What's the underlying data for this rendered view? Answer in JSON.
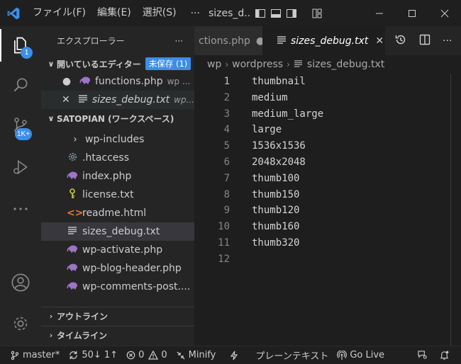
{
  "menu": {
    "file": "ファイル(F)",
    "edit": "編集(E)",
    "selection": "選択(S)",
    "more": "···"
  },
  "window": {
    "title": "sizes_d..."
  },
  "activity": {
    "explorer_badge": "1",
    "scm_badge": "1K+"
  },
  "sidebar": {
    "title": "エクスプローラー",
    "more": "···",
    "open_editors": {
      "label": "開いているエディター",
      "badge": "未保存 (1)",
      "items": [
        {
          "mark": "●",
          "name": "functions.php",
          "path": "wp ..."
        },
        {
          "mark": "✕",
          "name": "sizes_debug.txt",
          "path": "wp..."
        }
      ]
    },
    "workspace": {
      "label": "SATOPIAN (ワークスペース)",
      "items": [
        {
          "icon": "chevron",
          "name": "wp-includes"
        },
        {
          "icon": "gear",
          "name": ".htaccess"
        },
        {
          "icon": "php",
          "name": "index.php"
        },
        {
          "icon": "key",
          "name": "license.txt"
        },
        {
          "icon": "html",
          "name": "readme.html"
        },
        {
          "icon": "txt",
          "name": "sizes_debug.txt"
        },
        {
          "icon": "php",
          "name": "wp-activate.php"
        },
        {
          "icon": "php",
          "name": "wp-blog-header.php"
        },
        {
          "icon": "php",
          "name": "wp-comments-post...."
        }
      ]
    },
    "outline": "アウトライン",
    "timeline": "タイムライン"
  },
  "tabs": [
    {
      "name": "ctions.php",
      "dirty": "●"
    },
    {
      "name": "sizes_debug.txt",
      "close": "✕"
    }
  ],
  "breadcrumb": {
    "part1": "wp",
    "part2": "wordpress",
    "part3": "sizes_debug.txt"
  },
  "editor": {
    "lines": [
      "1",
      "2",
      "3",
      "4",
      "5",
      "6",
      "7",
      "8",
      "9",
      "10",
      "11",
      "12"
    ],
    "code": [
      "thumbnail",
      "medium",
      "medium_large",
      "large",
      "1536x1536",
      "2048x2048",
      "thumb100",
      "thumb150",
      "thumb120",
      "thumb160",
      "thumb320",
      ""
    ]
  },
  "status": {
    "branch": "master*",
    "sync": "50↓ 1↑",
    "errors": "0",
    "warnings": "0",
    "minify": "Minify",
    "plaintext": "プレーンテキスト",
    "golive": "Go Live"
  },
  "colors": {
    "accent": "#3b8eea",
    "php": "#a074c4",
    "html": "#e37933",
    "key": "#cbcb41"
  }
}
